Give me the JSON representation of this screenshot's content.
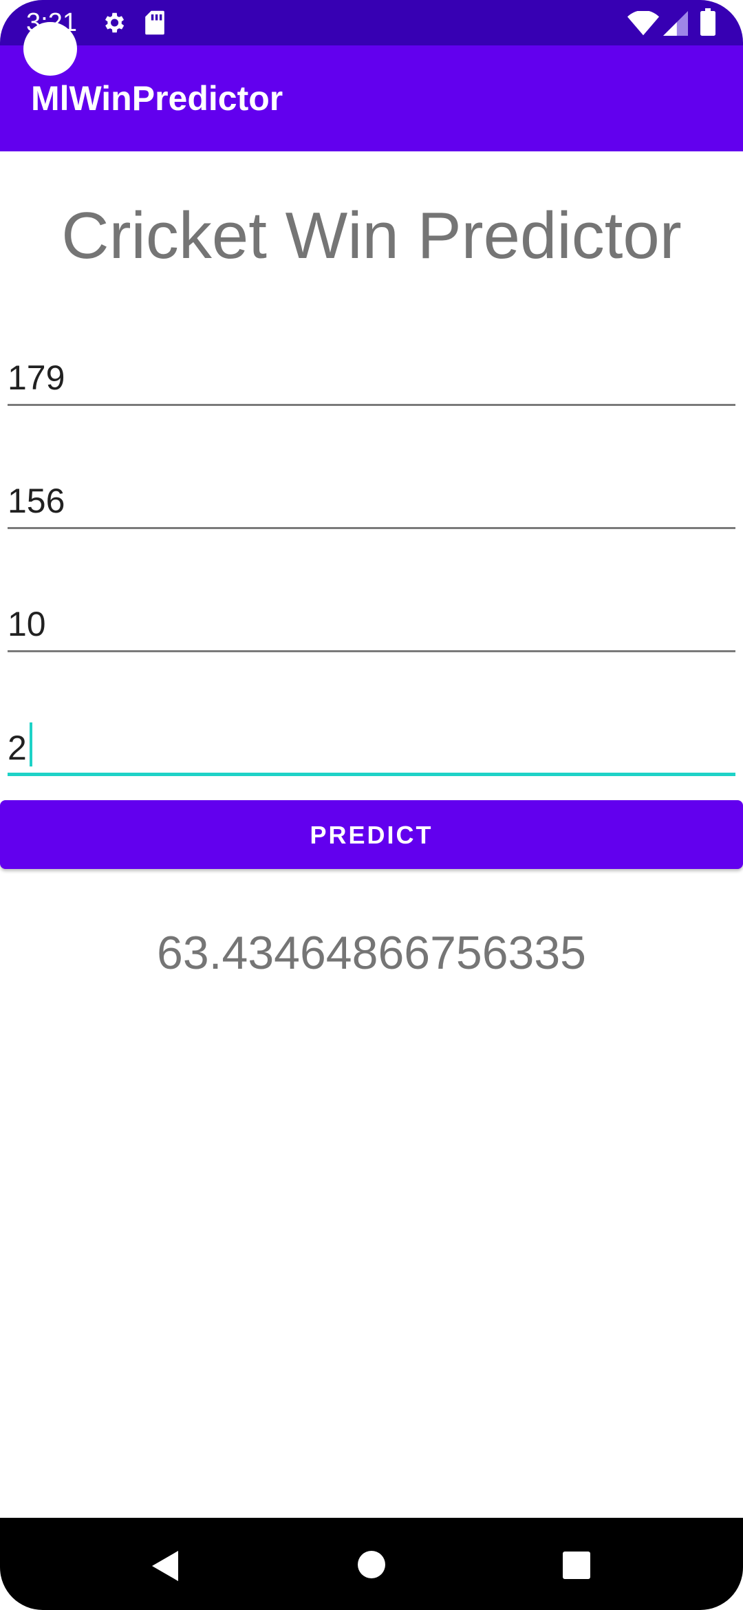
{
  "status_bar": {
    "time": "3:21",
    "icons": [
      "settings-icon",
      "sd-card-icon",
      "wifi-icon",
      "signal-icon",
      "battery-icon"
    ],
    "background": "#3700b3"
  },
  "app_bar": {
    "title": "MlWinPredictor",
    "background": "#6200ee"
  },
  "main": {
    "heading": "Cricket Win Predictor",
    "fields": [
      {
        "value": "179"
      },
      {
        "value": "156"
      },
      {
        "value": "10"
      },
      {
        "value": "2",
        "focused": true
      }
    ],
    "predict_label": "PREDICT",
    "result": "63.43464866756335",
    "accent": "#1ed2c7"
  },
  "nav_bar": {
    "buttons": [
      "back-icon",
      "home-icon",
      "recents-icon"
    ]
  }
}
